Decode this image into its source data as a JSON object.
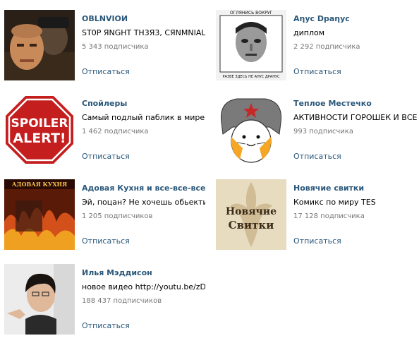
{
  "groups": [
    {
      "name": "OBLNVIOИ",
      "status": "ST0P ЯNGHT TH3Я3, CЯNMNIAL ...",
      "subscribers": "5 343 подписчика",
      "action": "Отписаться"
    },
    {
      "name": "Aηyc Dpaηyc",
      "status": "диплом",
      "subscribers": "2 292 подписчика",
      "action": "Отписаться",
      "avatar_top_text": "ОГЛЯНИСЬ ВОКРУГ",
      "avatar_bottom_text": "РАЗВЕ ЗДЕСЬ НЕ АНУС ДРАНУС"
    },
    {
      "name": "Спойлеры",
      "status": "Самый подлый паблик в мире.",
      "subscribers": "1 462 подписчика",
      "action": "Отписаться",
      "avatar_line1": "SPOILER",
      "avatar_line2": "ALERT!"
    },
    {
      "name": "Теплое Местечко",
      "status": "АКТИВНОСТИ ГОРОШЕК И ВСЕ ...",
      "subscribers": "993 подписчика",
      "action": "Отписаться"
    },
    {
      "name": "Адовая Кухня и все-все-все",
      "status": "Эй, поцан? Не хочешь обьекти...",
      "subscribers": "1 205 подписчиков",
      "action": "Отписаться",
      "avatar_text": "АДОВАЯ КУХНЯ"
    },
    {
      "name": "Новячие свитки",
      "status": "Комикс по миру TES",
      "subscribers": "17 128 подписчика",
      "action": "Отписаться",
      "avatar_line1": "Новячие",
      "avatar_line2": "Свитки"
    },
    {
      "name": "Илья Мэддисон",
      "status": "новое видео http://youtu.be/zD...",
      "subscribers": "188 437 подписчиков",
      "action": "Отписаться"
    }
  ],
  "colors": {
    "link": "#2b587a",
    "muted": "#777777"
  }
}
